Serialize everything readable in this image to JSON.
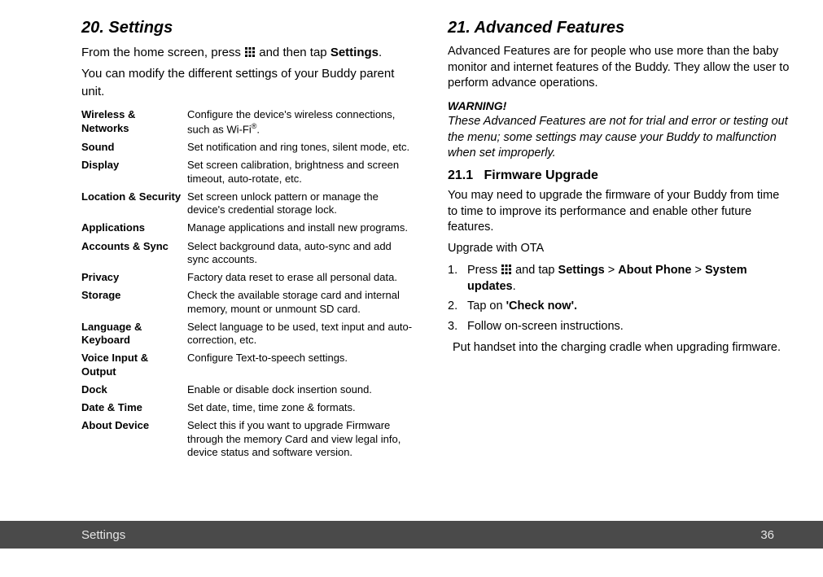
{
  "left": {
    "title": "20. Settings",
    "intro1_a": "From the home screen, press ",
    "intro1_b": " and then tap ",
    "intro1_settings": "Settings",
    "intro1_c": ".",
    "intro2": "You can modify the different settings of your Buddy parent unit.",
    "rows": [
      {
        "term": "Wireless & Networks",
        "desc_a": "Configure the device's wireless connections, such as Wi-Fi",
        "sup": "®",
        "desc_b": "."
      },
      {
        "term": "Sound",
        "desc_a": "Set notification and ring tones, silent mode, etc."
      },
      {
        "term": "Display",
        "desc_a": "Set screen calibration, brightness and screen timeout, auto-rotate, etc."
      },
      {
        "term": "Location & Security",
        "desc_a": "Set screen unlock pattern or manage the device's credential storage lock."
      },
      {
        "term": "Applications",
        "desc_a": "Manage applications and install new programs."
      },
      {
        "term": "Accounts & Sync",
        "desc_a": "Select background data, auto-sync and add sync accounts."
      },
      {
        "term": "Privacy",
        "desc_a": "Factory data reset to erase all personal data."
      },
      {
        "term": "Storage",
        "desc_a": "Check the available storage card and internal memory, mount or unmount SD card."
      },
      {
        "term": "Language & Keyboard",
        "desc_a": "Select language to be used, text input and auto-correction, etc."
      },
      {
        "term": "Voice Input & Output",
        "desc_a": "Configure Text-to-speech settings."
      },
      {
        "term": "Dock",
        "desc_a": "Enable or disable dock insertion sound."
      },
      {
        "term": "Date & Time",
        "desc_a": "Set date, time, time zone & formats."
      },
      {
        "term": "About Device",
        "desc_a": "Select this if you want to upgrade Firmware through the memory Card and view legal info, device status and software version."
      }
    ]
  },
  "right": {
    "title": "21. Advanced Features",
    "intro": "Advanced Features are for people who use more than the baby monitor and internet features of the Buddy. They allow the user to perform advance operations.",
    "warning_label": "WARNING!",
    "warning_body": "These Advanced Features are not for trial and error or testing out the menu; some settings may cause your Buddy to malfunction when set improperly.",
    "sub_num": "21.1",
    "sub_title": "Firmware Upgrade",
    "para1": "You may need to upgrade the firmware of your Buddy from time to time to improve its performance and enable other future features.",
    "para2": "Upgrade with OTA",
    "step1_a": "Press ",
    "step1_b": " and tap ",
    "step1_s": "Settings",
    "step1_c": " > ",
    "step1_ap": "About Phone",
    "step1_d": " > ",
    "step1_su": "System updates",
    "step1_e": ".",
    "step2_a": "Tap on ",
    "step2_b": "'Check now'.",
    "step3": "Follow on-screen instructions.",
    "note": "Put handset into the charging cradle when upgrading firmware."
  },
  "footer": {
    "chapter": "Settings",
    "page": "36"
  }
}
